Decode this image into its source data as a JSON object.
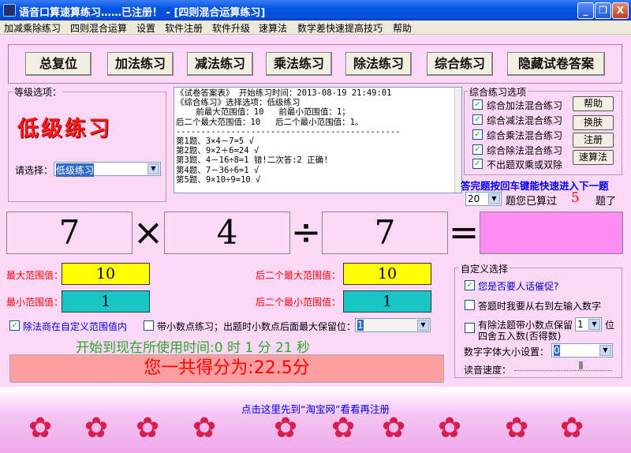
{
  "window": {
    "title": "语音口算速算练习……已注册！ - [四则混合运算练习]",
    "minimize": "_",
    "maximize": "❐",
    "close": "X"
  },
  "menu": [
    "加减乘除练习",
    "四则混合运算",
    "设置",
    "软件注册",
    "软件升级",
    "速算法",
    "数学差快速提高技巧",
    "帮助"
  ],
  "toolbar": [
    "总复位",
    "加法练习",
    "减法练习",
    "乘法练习",
    "除法练习",
    "综合练习",
    "隐藏试卷答案"
  ],
  "level": {
    "legend": "等级选项：",
    "current": "低级练习",
    "select_label": "请选择：",
    "select_value": "低级练习"
  },
  "log": [
    "《试卷答案表》 开始练习时间：2013-08-19 21:49:01",
    "《综合练习》选择选项：低级练习",
    "    前最大范围值：10   前最小范围值：1；",
    "后二个最大范围值：10   后二个最小范围值：1。",
    "---------------------------------------------",
    "第1题、3×4－7=5 √",
    "第2题、9×2＋6=24 √",
    "第3题、4－16÷8=1 错!二次答:2 正确!",
    "第4题、7－36÷6=1 √",
    "第5题、9×10÷9=10 √"
  ],
  "options": {
    "legend": "综合练习选项",
    "items": [
      {
        "label": "综合加法混合练习",
        "checked": true
      },
      {
        "label": "综合减法混合练习",
        "checked": true
      },
      {
        "label": "综合乘法混合练习",
        "checked": true
      },
      {
        "label": "综合除法混合练习",
        "checked": true
      },
      {
        "label": "不出题双乘或双除",
        "checked": true
      }
    ],
    "buttons": [
      "帮助",
      "换肤",
      "注册",
      "速算法"
    ]
  },
  "hint": "答完题按回车键能快速进入下一题",
  "progress": {
    "count_select": "20",
    "text1": "题您已算过",
    "done": "5",
    "text2": "题了"
  },
  "problem": {
    "a": "7",
    "op1": "×",
    "b": "4",
    "op2": "÷",
    "c": "7",
    "eq": "=",
    "answer": ""
  },
  "ranges": {
    "max_label": "最大范围值：",
    "max_value": "10",
    "min_label": "最小范围值：",
    "min_value": "1",
    "max2_label": "后二个最大范围值：",
    "max2_value": "10",
    "min2_label": "后二个最小范围值：",
    "min2_value": "1"
  },
  "options_row": {
    "div_label": "除法商在自定义范围值内",
    "decimal_label": "带小数点练习；出题时小数点后面最大保留位：",
    "decimal_value": "1"
  },
  "timer": "开始到现在所使用时间:0 时 1 分 21 秒",
  "score": "您一共得分为:22.5分",
  "custom": {
    "legend": "自定义选择",
    "opt1": "您是否要人话催促?",
    "opt2": "答题时我要从右到左输入数字",
    "opt3a": "有除法题带小数点保留",
    "opt3_value": "1",
    "opt3b": "位",
    "opt3c": "四舍五入数(否得数)",
    "font_label": "数字字体大小设置：",
    "font_value": "0",
    "speed_label": "读音速度："
  },
  "banner": {
    "text": "点击这里先到“淘宝网”看看再注册"
  },
  "colors": {
    "pink": "#fbd8f8",
    "yellow": "#ffff00",
    "teal": "#19c6c6",
    "red": "#ff0000",
    "blue_link": "#0000ff"
  }
}
